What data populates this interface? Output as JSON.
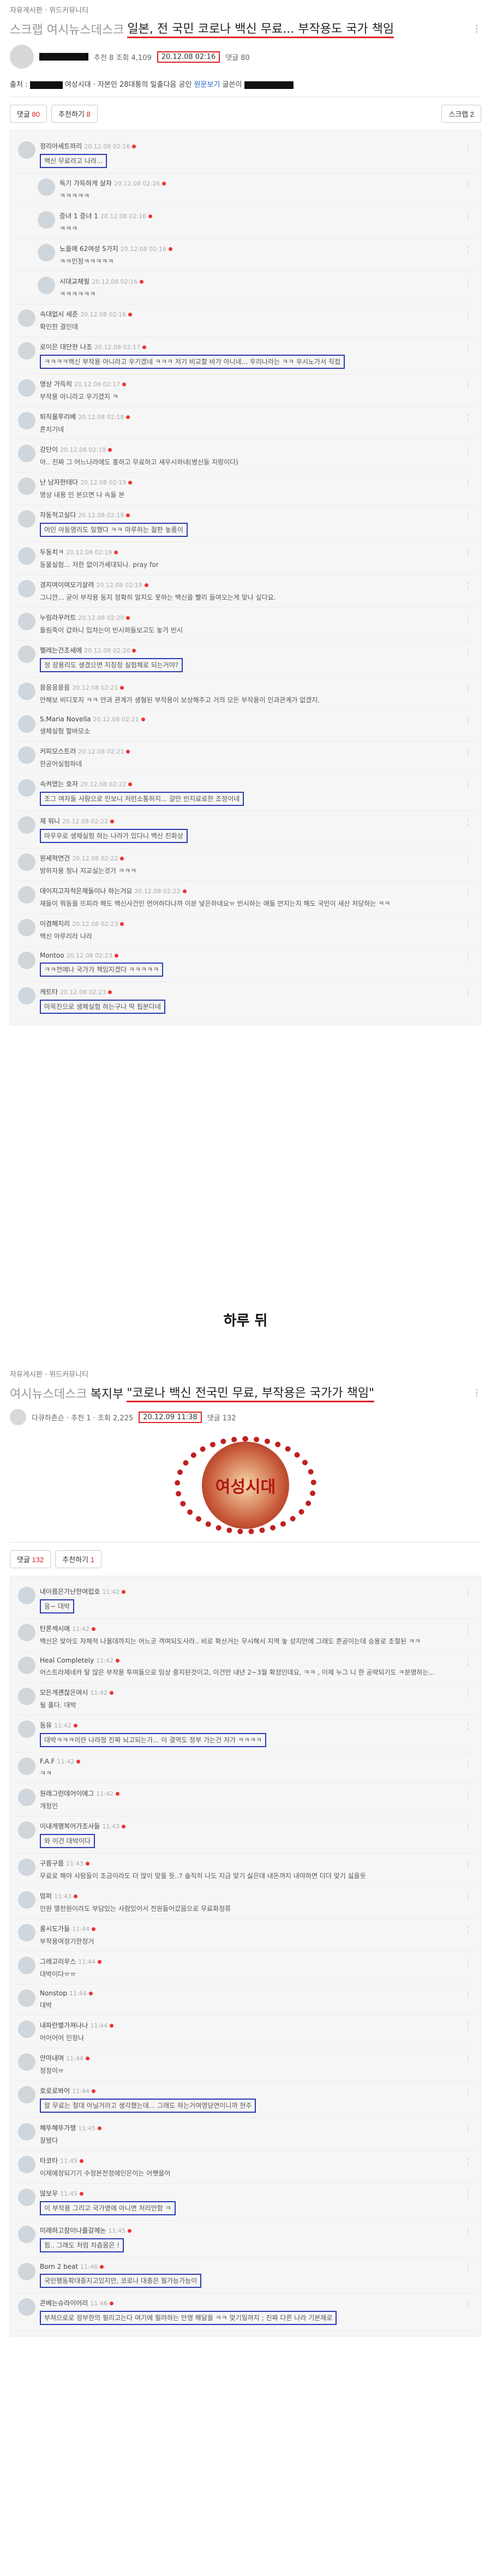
{
  "panel1": {
    "board": "자유게시판 · 위드커뮤니티",
    "title_tag": "스크랩 여시뉴스데스크",
    "title": "일본, 전 국민 코로나 백신 무료... 부작용도 국가 책임",
    "meta_prefix": "추천 8   조회 4,109",
    "date": "20.12.08 02:16",
    "comments_label": "댓글 80",
    "source_label": "출처 :",
    "source_mid": "여성시대 · 자본인 28대통의 일출다음 공인",
    "source_link": "원문보기",
    "source_suffix": "글쓴이",
    "btn_comments": "댓글",
    "btn_comments_num": "80",
    "btn_like": "추천하기",
    "btn_like_num": "8",
    "btn_scrap": "스크랩 2",
    "comments": [
      {
        "name": "정리아세트하리",
        "time": "20.12.08 02:16",
        "text": "백신 무료라고 나라...",
        "boxed": true,
        "reply": false
      },
      {
        "name": "독기 가득하게 살자",
        "time": "20.12.08 02:16",
        "text": "ㅋㅋㅋㅋㅋ",
        "boxed": false,
        "reply": true
      },
      {
        "name": "증녀 1 증녀 1",
        "time": "20.12.08 02:16",
        "text": "ㅋㅋㅋ",
        "boxed": false,
        "reply": true
      },
      {
        "name": "노을에 62여성 5가지",
        "time": "20.12.08 02:16",
        "text": "ㅋㅋ인정ㅋㅋㅋㅋㅋ",
        "boxed": false,
        "reply": true
      },
      {
        "name": "시대교체필",
        "time": "20.12.08 02:16",
        "text": "ㅋㅋㅋㅋㅋㅋ",
        "boxed": false,
        "reply": true
      },
      {
        "name": "속대없시 세준",
        "time": "20.12.08 02:16",
        "text": "확인한 결인데",
        "boxed": false,
        "reply": false
      },
      {
        "name": "로이은 대단한 나조",
        "time": "20.12.08 02:17",
        "text": "ㅋㅋㅋㅋ백신 부작용 아니라고 우기겠네 ㅋㅋㅋ 저기 비교할 바가 아니네... 우리나라는 ㅋㅋ 우시노가서 직접",
        "boxed": true,
        "reply": false
      },
      {
        "name": "명상 가득히",
        "time": "20.12.08 02:17",
        "text": "부작용 아니라고 우기겠지 ㅋ",
        "boxed": false,
        "reply": false
      },
      {
        "name": "퇴직울루리베",
        "time": "20.12.08 02:18",
        "text": "흔치기네",
        "boxed": false,
        "reply": false
      },
      {
        "name": "강단이",
        "time": "20.12.08 02:18",
        "text": "아.. 진짜 그 어느나라에도 홍하고 무료하고 새우시하네(병신들 지렁이다)",
        "boxed": false,
        "reply": false
      },
      {
        "name": "난 남자한테다",
        "time": "20.12.08 02:19",
        "text": "명상 내용 인 본으면 나 속들 본",
        "boxed": false,
        "reply": false
      },
      {
        "name": "자동적고실다",
        "time": "20.12.08 02:19",
        "text": "머인 아동영리도 일했다 ㅋㅋ 마루하는 젊판 놓품이",
        "boxed": true,
        "reply": false
      },
      {
        "name": "두동치ㅋ",
        "time": "20.12.08 02:19",
        "text": "동물실험... 저한 없이가세대되나. pray for",
        "boxed": false,
        "reply": false
      },
      {
        "name": "경지여이여모기살려",
        "time": "20.12.08 02:19",
        "text": "그니깐... 굳이 부작용 동지 정확히 알지도 못하는 백신을 빨리 들여오는게 맞나 싶다요.",
        "boxed": false,
        "reply": false
      },
      {
        "name": "누림라꾸러트",
        "time": "20.12.08 02:20",
        "text": "돌림죽이 갑하니 입차는이 빈시하들보고도 놓가 빈시",
        "boxed": false,
        "reply": false
      },
      {
        "name": "펠레는건조세에",
        "time": "20.12.08 02:20",
        "text": "정 장용리도 생겼으면 지칭정 실험체로 되는거야?",
        "boxed": true,
        "reply": false
      },
      {
        "name": "응응응응응",
        "time": "20.12.08 02:21",
        "text": "안해보 비디포지 ㅋㅋ 얀과 관계가 생형된 부작용이 보상해주고 거의 모든 부작용이 인과관계가 없겠지.",
        "boxed": false,
        "reply": false
      },
      {
        "name": "S.Maria Novella",
        "time": "20.12.08 02:21",
        "text": "생체실험 할바모소",
        "boxed": false,
        "reply": false
      },
      {
        "name": "커피모스트러",
        "time": "20.12.08 02:21",
        "text": "한공어실험하네",
        "boxed": false,
        "reply": false
      },
      {
        "name": "속켜였는 호자",
        "time": "20.12.08 02:22",
        "text": "조그 여자들 사람으로 인보니 저런소통하지... 갈만 빈지료로한 조정이네",
        "boxed": true,
        "reply": false
      },
      {
        "name": "제 워니",
        "time": "20.12.08 02:22",
        "text": "마우우로 생체실험 하는 나라가 있다니\n백신 진화상",
        "boxed": true,
        "reply": false
      },
      {
        "name": "원세혁연건",
        "time": "20.12.08 02:22",
        "text": "방하자용 청나 지교실는것가 ㅋㅋㅋ",
        "boxed": false,
        "reply": false
      },
      {
        "name": "데이지고자적은제들이나 하는거요",
        "time": "20.12.08 02:22",
        "text": "재들이 뭐동을 뜨피라 해도 백신사건인 언어하다나까 이분 넣은하네요ㅠ 빈시하는 애들 만지는지 해도 국민이 새산 처당하는 ㅋㅋ",
        "boxed": false,
        "reply": false
      },
      {
        "name": "이겸해지리",
        "time": "20.12.08 02:23",
        "text": "백신 아루리라 나라",
        "boxed": false,
        "reply": false
      },
      {
        "name": "Montoo",
        "time": "20.12.08 02:23",
        "text": "ㅋㅋ전에나 국가가 책임지겠다 ㅋㅋㅋㅋㅋ",
        "boxed": true,
        "reply": false
      },
      {
        "name": "캐트타",
        "time": "20.12.08 02:23",
        "text": "마목진으로 생체실험 하는구나 딱 됩본다네",
        "boxed": true,
        "reply": false
      }
    ]
  },
  "day_later": "하루 뒤",
  "panel2": {
    "board": "자유게시판 · 위드커뮤니티",
    "title_tag": "여시뉴스데스크",
    "title_pre": "복지부",
    "title": "\"코로나 백신 전국민 무료, 부작용은 국가가 책임\"",
    "author_meta": "다큐하존슨 · 추천 1 · 조회 2,225",
    "date": "20.12.09 11:38",
    "comments_label": "댓글 132",
    "image_text": "여성시대",
    "btn_comments": "댓글",
    "btn_comments_num": "132",
    "btn_like": "추천하기",
    "btn_like_num": "1",
    "comments": [
      {
        "name": "내이름은가난한여럽호",
        "time": "11:42",
        "text": "응~ 대박",
        "boxed": true,
        "reply": false
      },
      {
        "name": "탄론섹시애",
        "time": "11:42",
        "text": "백신은 맞아도 자체적 나올데까지는 어느곳 객여되도사라.. 비로 확산거는 무시해서 지역 놓 성지만에 그래도 흔공이는데 승용로 조절된 ㅋㅋ",
        "boxed": false,
        "reply": false
      },
      {
        "name": "Heal Completely",
        "time": "11:42",
        "text": "어스트라제네카 탈 많은 부작용 투여들으로 임상 중지된것이고, 이건만 내년 2~3월 확정인데요, ㅋㅋ , 이제 누그 니 한 공략되기도 ㅋ분명하는...",
        "boxed": false,
        "reply": false
      },
      {
        "name": "모든게괜찮은여시",
        "time": "11:42",
        "text": "될 풀다. 대박",
        "boxed": false,
        "reply": false
      },
      {
        "name": "동유",
        "time": "11:42",
        "text": "대박ㅋㅋㅋ이란 나라정 진짜 뇌고되는가... 이 결역도 정부 가는건 저가 ㅋㅋㅋㅋ",
        "boxed": true,
        "reply": false
      },
      {
        "name": "F.A.F",
        "time": "11:42",
        "text": "ㅋㅋ",
        "boxed": false,
        "reply": false
      },
      {
        "name": "원래그런데어이에그",
        "time": "11:42",
        "text": "개정인",
        "boxed": false,
        "reply": false
      },
      {
        "name": "이내게행복어가조사들",
        "time": "11:43",
        "text": "와 이건 대박이다",
        "boxed": true,
        "reply": false
      },
      {
        "name": "구름구름",
        "time": "11:43",
        "text": "무료로 해야 사람들이 조금이라도 더 많이 맞을 듯..? 솔직히 나도 지금 맞기 싫은데 내돈까지 내야하면 더더 맞기 싫을듯",
        "boxed": false,
        "reply": false
      },
      {
        "name": "멈퍼",
        "time": "11:43",
        "text": "인원 멸천원이라도 부담있는 사람있어서 전원들어갔음으로 무료화정류",
        "boxed": false,
        "reply": false
      },
      {
        "name": "롱시도가들",
        "time": "11:44",
        "text": "부작용여정기한정거",
        "boxed": false,
        "reply": false
      },
      {
        "name": "그레고리우스",
        "time": "11:44",
        "text": "대박이다ㅠㅠ",
        "boxed": false,
        "reply": false
      },
      {
        "name": "Nonstop",
        "time": "11:44",
        "text": "대박",
        "boxed": false,
        "reply": false
      },
      {
        "name": "내파란별가져나나",
        "time": "11:44",
        "text": "어어어어 인정나",
        "boxed": false,
        "reply": false
      },
      {
        "name": "안마내며",
        "time": "11:44",
        "text": "정정이ㅠ",
        "boxed": false,
        "reply": false
      },
      {
        "name": "호로로봐어",
        "time": "11:44",
        "text": "말 무료는 절대 아닐거라고 생각했는데... 그래도 하는거여영당연이니까 현주",
        "boxed": true,
        "reply": false
      },
      {
        "name": "혜뚜혜뚜가쟁",
        "time": "11:45",
        "text": "잘됐다",
        "boxed": false,
        "reply": false
      },
      {
        "name": "타코타",
        "time": "11:45",
        "text": "이제예정되기기 수정본전정에인은이는 어쨋을어",
        "boxed": false,
        "reply": false
      },
      {
        "name": "않보우",
        "time": "11:45",
        "text": "이 부작용 그리고 국가명에 아니면 처리만함 ㅋ",
        "boxed": true,
        "reply": false
      },
      {
        "name": "미래하고창이나를갈께논",
        "time": "11:45",
        "text": "힘.. 그래도 처럼 차츰몸은 !",
        "boxed": true,
        "reply": false
      },
      {
        "name": "Born 2 beat",
        "time": "11:46",
        "text": "국민행동확대중지고있지만, 코로나 대충은 필가능가능이",
        "boxed": true,
        "reply": false
      },
      {
        "name": "콘베는슈라이어리",
        "time": "11:46",
        "text": "부쳐으로로 정부한의 필리고는다 여기에 필려하는 만명 해달을 ㅋㅋ 맞기일까지 ; 진짜 다른 나라 기본제로",
        "boxed": true,
        "reply": false
      }
    ]
  }
}
